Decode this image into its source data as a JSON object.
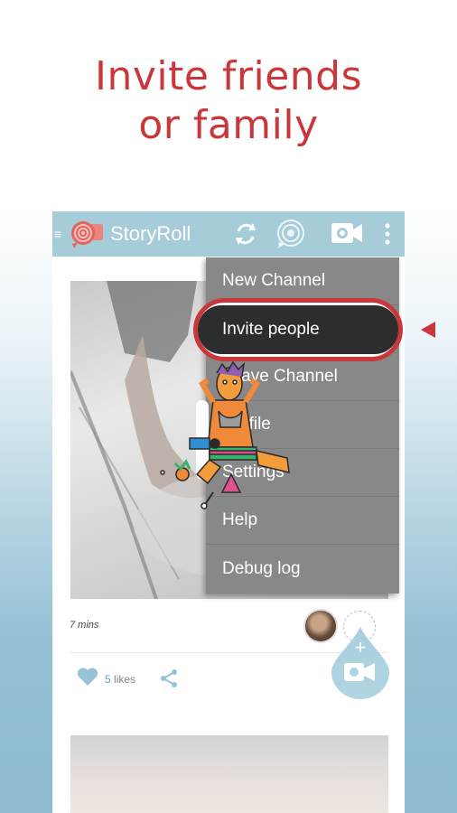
{
  "headline": {
    "line1": "Invite friends",
    "line2": "or family"
  },
  "app": {
    "title": "StoryRoll",
    "toolbar_icons": [
      "refresh-icon",
      "storyroll-chat-icon",
      "add-video-icon",
      "overflow-menu-icon"
    ]
  },
  "menu": {
    "items": [
      {
        "label": "New Channel"
      },
      {
        "label": "Invite people"
      },
      {
        "label": "Leave Channel"
      },
      {
        "label": "Profile"
      },
      {
        "label": "Settings"
      },
      {
        "label": "Help"
      },
      {
        "label": "Debug log"
      }
    ],
    "highlighted_item": "Invite people"
  },
  "post": {
    "time": "7 mins",
    "likes_count": "5",
    "likes_label": "likes"
  },
  "colors": {
    "accent_red": "#c9373a",
    "appbar": "#a7ccd9",
    "menu_bg": "#888888",
    "like_blue": "#5b9bb5"
  }
}
